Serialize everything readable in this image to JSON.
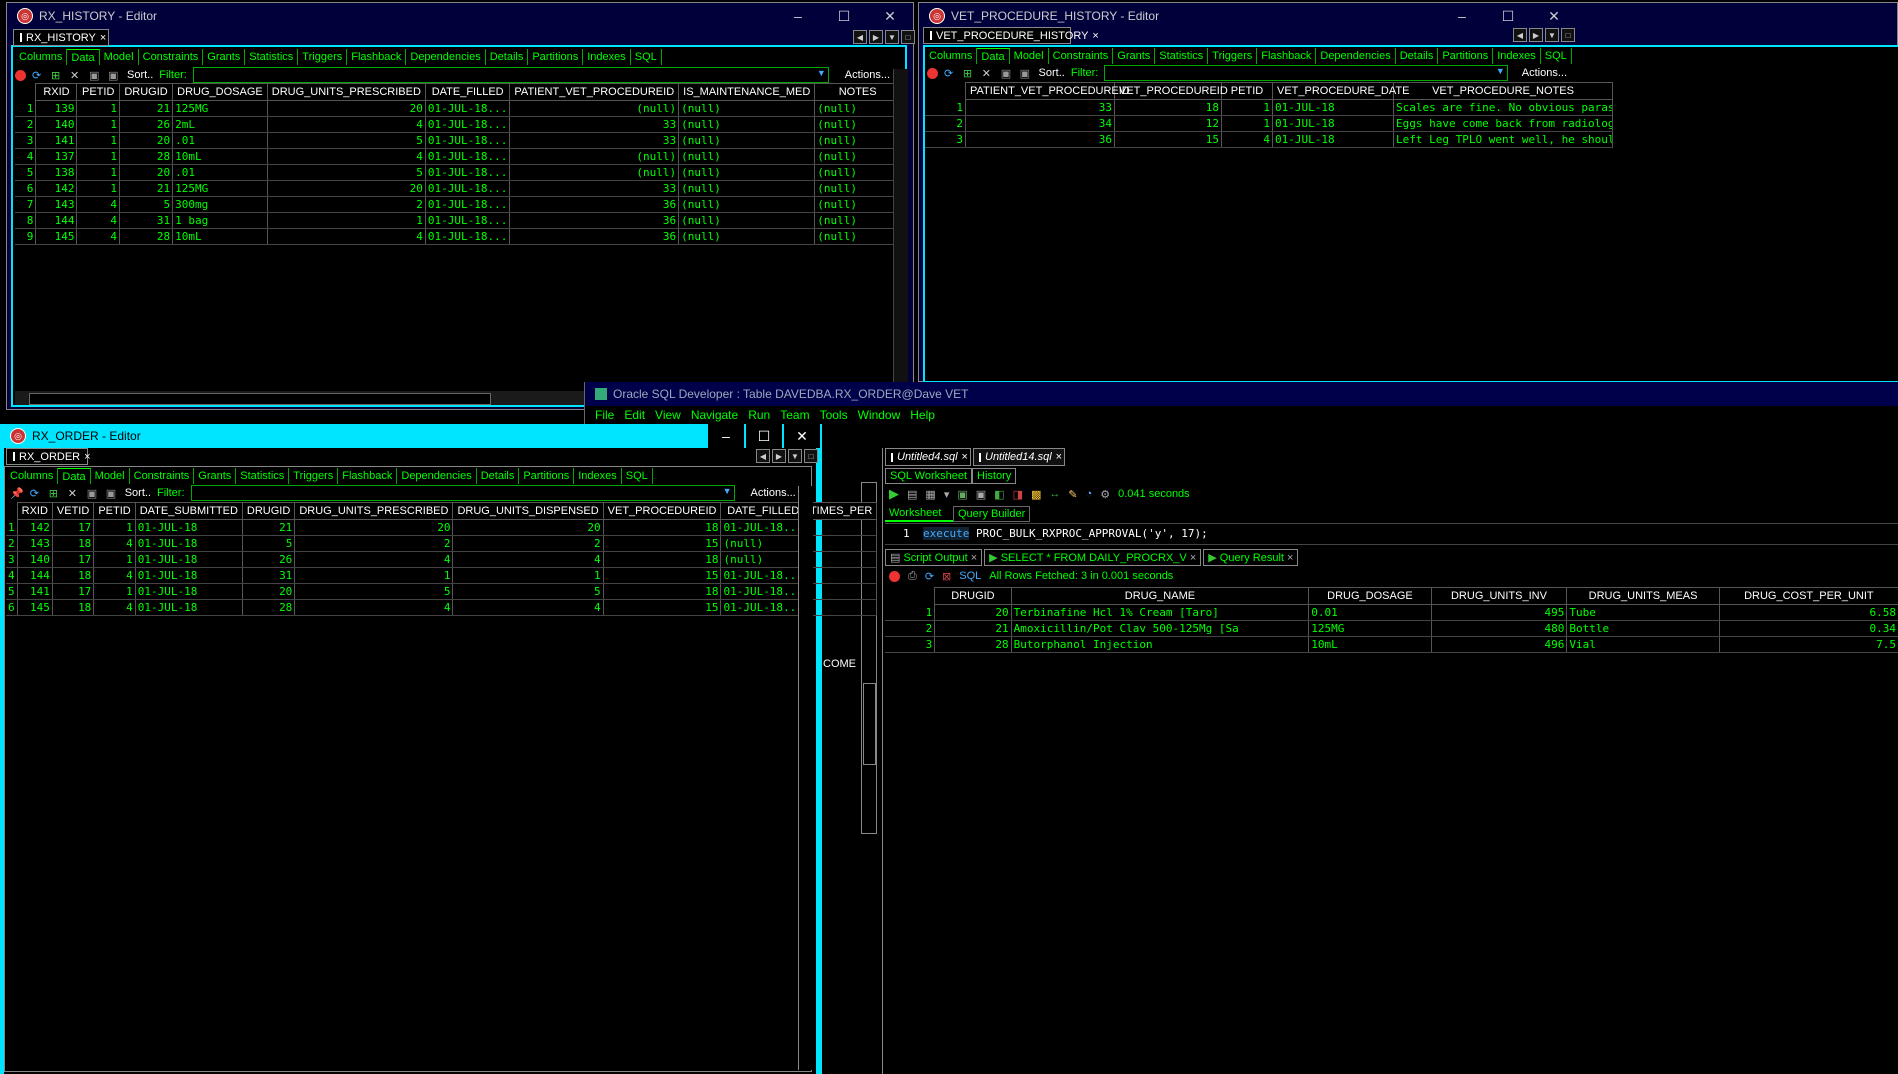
{
  "rx_history": {
    "window_title": "RX_HISTORY - Editor",
    "doc_tab": "RX_HISTORY",
    "subtabs": [
      "Columns",
      "Data",
      "Model",
      "Constraints",
      "Grants",
      "Statistics",
      "Triggers",
      "Flashback",
      "Dependencies",
      "Details",
      "Partitions",
      "Indexes",
      "SQL"
    ],
    "sort_label": "Sort..",
    "filter_label": "Filter:",
    "actions_label": "Actions...",
    "columns": [
      "RXID",
      "PETID",
      "DRUGID",
      "DRUG_DOSAGE",
      "DRUG_UNITS_PRESCRIBED",
      "DATE_FILLED",
      "PATIENT_VET_PROCEDUREID",
      "IS_MAINTENANCE_MED",
      "NOTES"
    ],
    "rows": [
      [
        "1",
        "139",
        "1",
        "21",
        "125MG",
        "20",
        "01-JUL-18...",
        "(null)",
        "(null)",
        "(null)"
      ],
      [
        "2",
        "140",
        "1",
        "26",
        "2mL",
        "4",
        "01-JUL-18...",
        "33",
        "(null)",
        "(null)"
      ],
      [
        "3",
        "141",
        "1",
        "20",
        ".01",
        "5",
        "01-JUL-18...",
        "33",
        "(null)",
        "(null)"
      ],
      [
        "4",
        "137",
        "1",
        "28",
        "10mL",
        "4",
        "01-JUL-18...",
        "(null)",
        "(null)",
        "(null)"
      ],
      [
        "5",
        "138",
        "1",
        "20",
        ".01",
        "5",
        "01-JUL-18...",
        "(null)",
        "(null)",
        "(null)"
      ],
      [
        "6",
        "142",
        "1",
        "21",
        "125MG",
        "20",
        "01-JUL-18...",
        "33",
        "(null)",
        "(null)"
      ],
      [
        "7",
        "143",
        "4",
        "5",
        "300mg",
        "2",
        "01-JUL-18...",
        "36",
        "(null)",
        "(null)"
      ],
      [
        "8",
        "144",
        "4",
        "31",
        "1 bag",
        "1",
        "01-JUL-18...",
        "36",
        "(null)",
        "(null)"
      ],
      [
        "9",
        "145",
        "4",
        "28",
        "10mL",
        "4",
        "01-JUL-18...",
        "36",
        "(null)",
        "(null)"
      ]
    ]
  },
  "vet_procedure_history": {
    "window_title": "VET_PROCEDURE_HISTORY - Editor",
    "doc_tab": "VET_PROCEDURE_HISTORY",
    "subtabs": [
      "Columns",
      "Data",
      "Model",
      "Constraints",
      "Grants",
      "Statistics",
      "Triggers",
      "Flashback",
      "Dependencies",
      "Details",
      "Partitions",
      "Indexes",
      "SQL"
    ],
    "sort_label": "Sort..",
    "filter_label": "Filter:",
    "actions_label": "Actions...",
    "columns": [
      "PATIENT_VET_PROCEDUREID",
      "VET_PROCEDUREID",
      "PETID",
      "VET_PROCEDURE_DATE",
      "VET_PROCEDURE_NOTES"
    ],
    "rows": [
      [
        "1",
        "33",
        "18",
        "1",
        "01-JUL-18",
        "Scales are fine. No obvious parasi"
      ],
      [
        "2",
        "34",
        "12",
        "1",
        "01-JUL-18",
        "Eggs have come back from radiology"
      ],
      [
        "3",
        "36",
        "15",
        "4",
        "01-JUL-18",
        "Left Leg TPLO went well, he should"
      ]
    ]
  },
  "main_app": {
    "title": "Oracle SQL Developer : Table DAVEDBA.RX_ORDER@Dave VET",
    "menu": [
      "File",
      "Edit",
      "View",
      "Navigate",
      "Run",
      "Team",
      "Tools",
      "Window",
      "Help"
    ]
  },
  "rx_order": {
    "window_title": "RX_ORDER - Editor",
    "doc_tab": "RX_ORDER",
    "subtabs": [
      "Columns",
      "Data",
      "Model",
      "Constraints",
      "Grants",
      "Statistics",
      "Triggers",
      "Flashback",
      "Dependencies",
      "Details",
      "Partitions",
      "Indexes",
      "SQL"
    ],
    "sort_label": "Sort..",
    "filter_label": "Filter:",
    "actions_label": "Actions...",
    "columns": [
      "RXID",
      "VETID",
      "PETID",
      "DATE_SUBMITTED",
      "DRUGID",
      "DRUG_UNITS_PRESCRIBED",
      "DRUG_UNITS_DISPENSED",
      "VET_PROCEDUREID",
      "DATE_FILLED",
      "TIMES_PER"
    ],
    "rows": [
      [
        "1",
        "142",
        "17",
        "1",
        "01-JUL-18",
        "21",
        "20",
        "20",
        "18",
        "01-JUL-18...",
        "("
      ],
      [
        "2",
        "143",
        "18",
        "4",
        "01-JUL-18",
        "5",
        "2",
        "2",
        "15",
        "(null)",
        "("
      ],
      [
        "3",
        "140",
        "17",
        "1",
        "01-JUL-18",
        "26",
        "4",
        "4",
        "18",
        "(null)",
        "("
      ],
      [
        "4",
        "144",
        "18",
        "4",
        "01-JUL-18",
        "31",
        "1",
        "1",
        "15",
        "01-JUL-18...",
        "("
      ],
      [
        "5",
        "141",
        "17",
        "1",
        "01-JUL-18",
        "20",
        "5",
        "5",
        "18",
        "01-JUL-18...",
        "("
      ],
      [
        "6",
        "145",
        "18",
        "4",
        "01-JUL-18",
        "28",
        "4",
        "4",
        "15",
        "01-JUL-18...",
        "("
      ]
    ]
  },
  "sql_worksheet": {
    "file_tabs": [
      "Untitled4.sql",
      "Untitled14.sql"
    ],
    "panel_tabs": [
      "SQL Worksheet",
      "History"
    ],
    "timing": "0.041 seconds",
    "sub_tabs": [
      "Worksheet",
      "Query Builder"
    ],
    "line_number": "1",
    "code_keyword": "execute",
    "code_rest": " PROC_BULK_RXPROC_APPROVAL('y', 17);",
    "result_tabs": [
      "Script Output",
      "SELECT * FROM DAILY_PROCRX_V",
      "Query Result"
    ],
    "sql_label": "SQL",
    "fetch_status": "All Rows Fetched: 3 in 0.001 seconds",
    "columns": [
      "DRUGID",
      "DRUG_NAME",
      "DRUG_DOSAGE",
      "DRUG_UNITS_INV",
      "DRUG_UNITS_MEAS",
      "DRUG_COST_PER_UNIT"
    ],
    "rows": [
      [
        "1",
        "20",
        "Terbinafine Hcl 1% Cream [Taro]",
        "0.01",
        "495",
        "Tube",
        "6.58"
      ],
      [
        "2",
        "21",
        "Amoxicillin/Pot Clav 500-125Mg [Sa",
        "125MG",
        "480",
        "Bottle",
        "0.34"
      ],
      [
        "3",
        "28",
        "Butorphanol Injection",
        "10mL",
        "496",
        "Vial",
        "7.5"
      ]
    ]
  },
  "side_fragment_text": "COME",
  "colors": {
    "accent_cyan": "#00e5ff",
    "navy": "#00004a",
    "grid_text": "#00ff00"
  }
}
